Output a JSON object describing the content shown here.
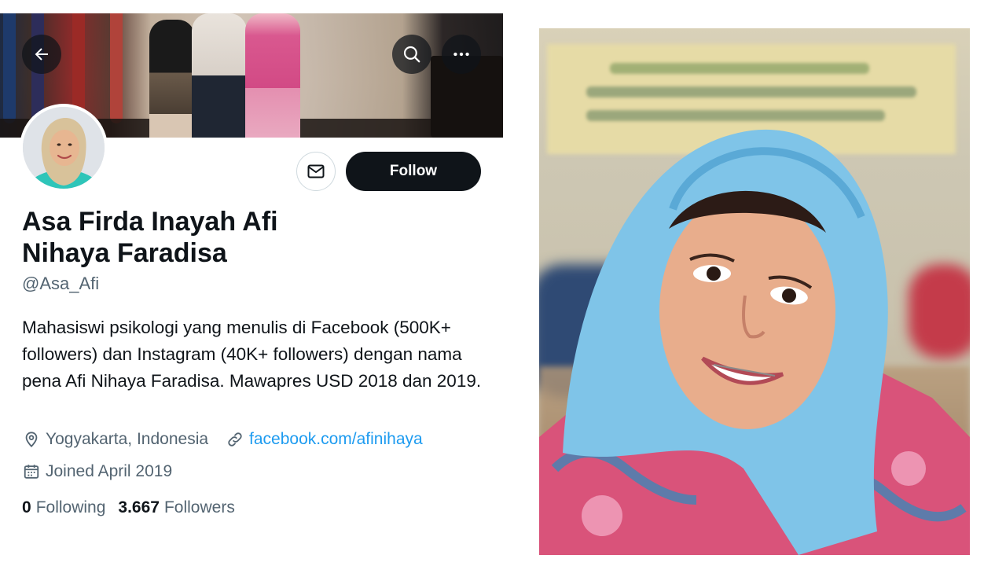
{
  "profile": {
    "display_name": "Asa Firda Inayah Afi Nihaya Faradisa",
    "handle": "@Asa_Afi",
    "bio": "Mahasiswi psikologi yang menulis di Facebook (500K+ followers) dan Instagram (40K+ followers) dengan nama pena Afi Nihaya Faradisa. Mawapres USD 2018 dan 2019.",
    "location": "Yogyakarta, Indonesia",
    "website": "facebook.com/afinihaya",
    "joined": "Joined April 2019",
    "following_count": "0",
    "following_label": "Following",
    "followers_count": "3.667",
    "followers_label": "Followers"
  },
  "actions": {
    "follow_label": "Follow",
    "back_icon": "arrow-left-icon",
    "search_icon": "search-icon",
    "more_icon": "more-horizontal-icon",
    "message_icon": "mail-icon"
  },
  "colors": {
    "text_primary": "#0f1419",
    "text_secondary": "#536471",
    "link": "#1d9bf0",
    "follow_bg": "#0f1419"
  }
}
